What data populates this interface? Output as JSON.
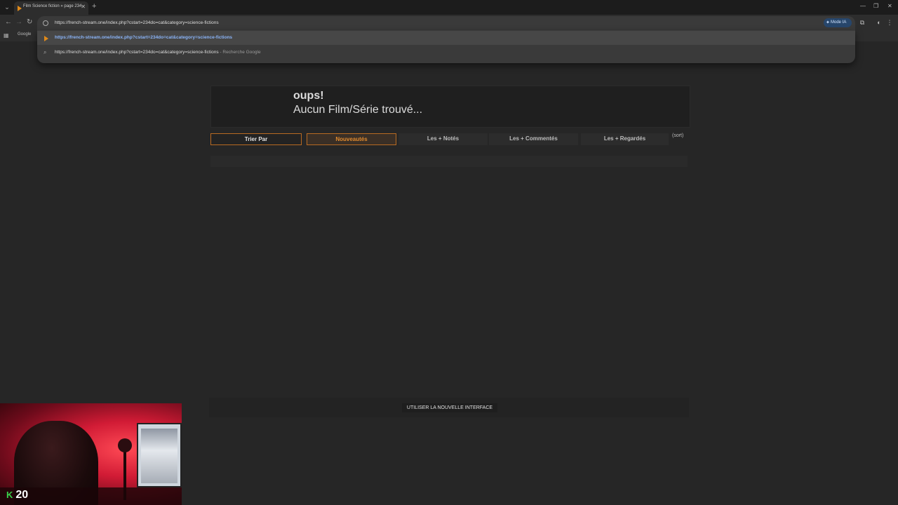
{
  "browser": {
    "tab_title": "Film Science fiction » page 234",
    "url": "https://french-stream.one/index.php?cstart=234do=cat&category=science-fictions",
    "mode_ia_label": "Mode IA",
    "bookmark_google": "Google"
  },
  "omnibox": {
    "suggestions": [
      {
        "text": "https://french-stream.one/index.php?cstart=234do=cat&category=science-fictions",
        "sub": ""
      },
      {
        "text": "https://french-stream.one/index.php?cstart=234do=cat&category=science-fictions",
        "sub": " - Recherche Google"
      }
    ]
  },
  "page": {
    "oops_title": "oups!",
    "oops_message": "Aucun Film/Série trouvé...",
    "sort_buttons": {
      "trier": "Trier Par",
      "nouveautes": "Nouveautés",
      "notes": "Les + Notés",
      "commentes": "Les + Commentés",
      "regardes": "Les + Regardés"
    },
    "sort_label": "(sort)",
    "new_interface_button": "UTILISER LA NOUVELLE INTERFACE"
  },
  "overlay": {
    "counter": "20",
    "counter_icon": "kick-logo-icon"
  },
  "colors": {
    "accent_orange": "#e08a2e",
    "background": "#262626",
    "kick_green": "#3ad24a"
  }
}
